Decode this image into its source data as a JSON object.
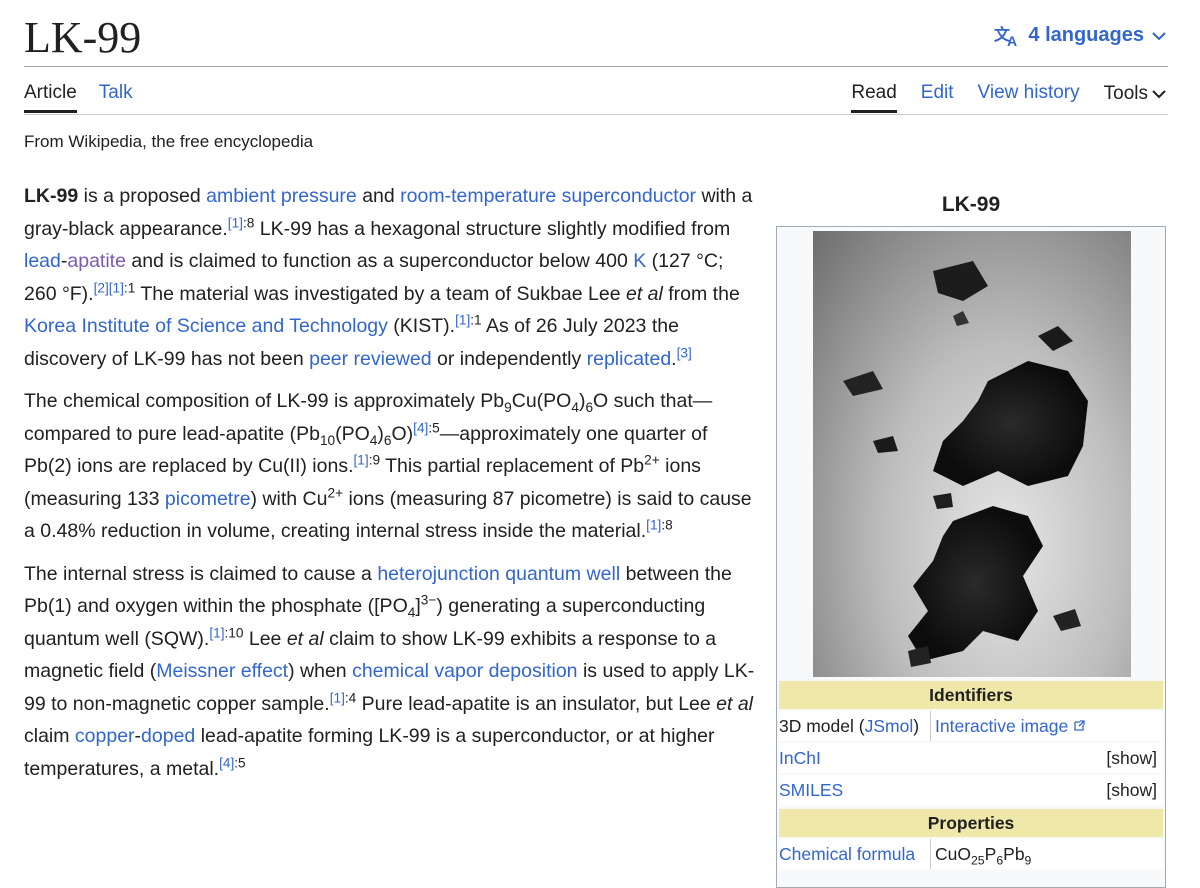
{
  "page": {
    "title": "LK-99",
    "languages": "4 languages",
    "from": "From Wikipedia, the free encyclopedia"
  },
  "tabs": {
    "article": "Article",
    "talk": "Talk",
    "read": "Read",
    "edit": "Edit",
    "history": "View history",
    "tools": "Tools"
  },
  "p1": {
    "t1": "LK-99",
    "t2": " is a proposed ",
    "l1": "ambient pressure",
    "t3": " and ",
    "l2": "room-temperature superconductor",
    "t4": " with a gray-black appearance.",
    "r1": "[1]",
    "r1b": ":8",
    "t5": " LK-99 has a hexagonal structure slightly modified from ",
    "l3": "lead",
    "t6": "-",
    "l4": "apatite",
    "t7": " and is claimed to function as a superconductor below 400 ",
    "l5": "K",
    "t8": " (127 °C; 260 °F).",
    "r2": "[2][1]",
    "r2b": ":1",
    "t9": " The material was investigated by a team of Sukbae Lee ",
    "i1": "et al",
    "t10": " from the ",
    "l6": "Korea Institute of Science and Technology",
    "t11": " (KIST).",
    "r3": "[1]",
    "r3b": ":1",
    "t12": " As of 26 July 2023 the discovery of LK-99 has not been ",
    "l7": "peer reviewed",
    "t13": " or independently ",
    "l8": "replicated",
    "t14": ".",
    "r4": "[3]"
  },
  "p2": {
    "t1": "The chemical composition of LK-99 is approximately Pb",
    "s1": "9",
    "t2": "Cu(PO",
    "s2": "4",
    "t3": ")",
    "s3": "6",
    "t4": "O such that—compared to pure lead-apatite (Pb",
    "s4": "10",
    "t5": "(PO",
    "s5": "4",
    "t6": ")",
    "s6": "6",
    "t7": "O)",
    "r1": "[4]",
    "r1b": ":5",
    "t8": "—approximately one quarter of Pb(2) ions are replaced by Cu(II) ions.",
    "r2": "[1]",
    "r2b": ":9",
    "t9": " This partial replacement of Pb",
    "u1": "2+",
    "t10": " ions (measuring 133 ",
    "l1": "picometre",
    "t11": ") with Cu",
    "u2": "2+",
    "t12": " ions (measuring 87 picometre) is said to cause a 0.48% reduction in volume, creating internal stress inside the material.",
    "r3": "[1]",
    "r3b": ":8"
  },
  "p3": {
    "t1": "The internal stress is claimed to cause a ",
    "l1": "heterojunction quantum well",
    "t2": " between the Pb(1) and oxygen within the phosphate ([PO",
    "s1": "4",
    "t3": "]",
    "u1": "3−",
    "t4": ") generating a superconducting quantum well (SQW).",
    "r1": "[1]",
    "r1b": ":10",
    "t5": " Lee ",
    "i1": "et al",
    "t6": " claim to show LK-99 exhibits a response to a magnetic field (",
    "l2": "Meissner effect",
    "t7": ") when ",
    "l3": "chemical vapor deposition",
    "t8": " is used to apply LK-99 to non-magnetic copper sample.",
    "r2": "[1]",
    "r2b": ":4",
    "t9": " Pure lead-apatite is an insulator, but Lee ",
    "i2": "et al",
    "t10": " claim ",
    "l4": "copper",
    "t11": "-",
    "l5": "doped",
    "t12": " lead-apatite forming LK-99 is a superconductor, or at higher temperatures, a metal.",
    "r3": "[4]",
    "r3b": ":5"
  },
  "infobox": {
    "title": "LK-99",
    "identifiers": "Identifiers",
    "model_label_a": "3D model (",
    "model_label_link": "JSmol",
    "model_label_b": ")",
    "model_value": "Interactive image",
    "inchi": "InChI",
    "smiles": "SMILES",
    "show": "[show]",
    "properties": "Properties",
    "formula_label": "Chemical formula",
    "formula_a": "CuO",
    "formula_s1": "25",
    "formula_b": "P",
    "formula_s2": "6",
    "formula_c": "Pb",
    "formula_s3": "9"
  },
  "colors": {
    "link": "#3366cc",
    "visited": "#795cb2",
    "section_bg": "#f0e8a8"
  }
}
